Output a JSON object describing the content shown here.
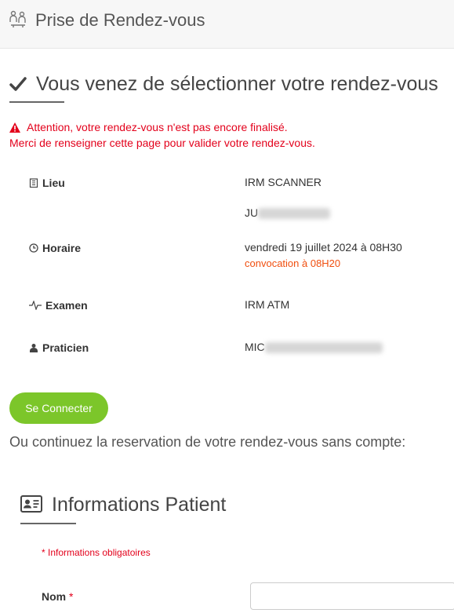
{
  "header": {
    "title": "Prise de Rendez-vous",
    "icon": "consultation-icon"
  },
  "selection": {
    "title": "Vous venez de sélectionner votre rendez-vous",
    "icon": "check-icon"
  },
  "alert": {
    "line1": "Attention, votre rendez-vous n'est pas encore finalisé.",
    "line2": "Merci de renseigner cette page pour valider votre rendez-vous.",
    "color": "#e3001b"
  },
  "details": {
    "lieu": {
      "label": "Lieu",
      "value": "IRM SCANNER",
      "value2": "JU"
    },
    "horaire": {
      "label": "Horaire",
      "value": "vendredi 19 juillet 2024 à 08H30",
      "convocation": "convocation à 08H20"
    },
    "examen": {
      "label": "Examen",
      "value": "IRM ATM"
    },
    "praticien": {
      "label": "Praticien",
      "value": "MIC"
    }
  },
  "actions": {
    "login_label": "Se Connecter",
    "login_color": "#7cc62a"
  },
  "continue_text": "Ou continuez la reservation de votre rendez-vous sans compte:",
  "patient": {
    "title": "Informations Patient",
    "required_note": "* Informations obligatoires",
    "nom_label": "Nom",
    "nom_required": "*",
    "nom_value": ""
  }
}
